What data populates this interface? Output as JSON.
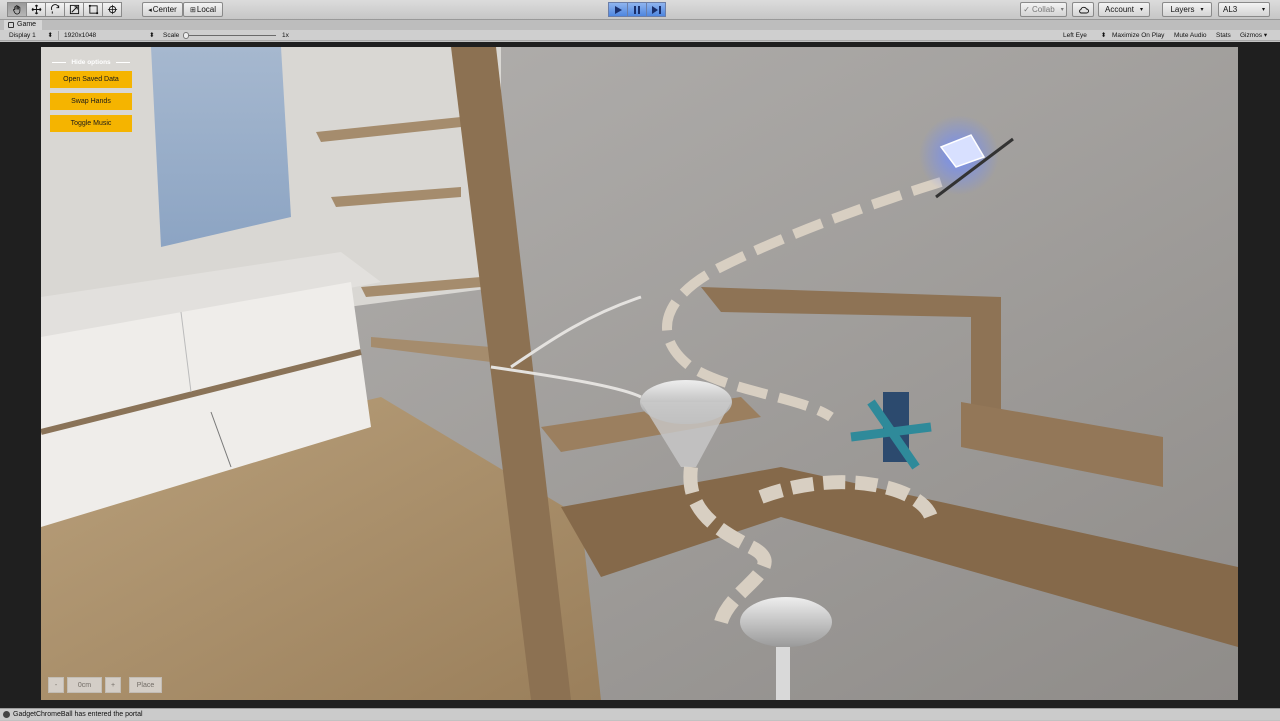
{
  "toolbar": {
    "tools": [
      "hand-tool",
      "move-tool",
      "rotate-tool",
      "scale-tool",
      "rect-tool",
      "transform-tool"
    ],
    "pivot_label": "Center",
    "space_label": "Local",
    "collab_label": "Collab",
    "account_label": "Account",
    "layers_label": "Layers",
    "layout_label": "AL3"
  },
  "tab": {
    "label": "Game"
  },
  "gamebar": {
    "display": "Display 1",
    "resolution": "1920x1048",
    "scale_label": "Scale",
    "scale_value": "1x",
    "scale_fraction": 0.0,
    "eye": "Left Eye",
    "maximize": "Maximize On Play",
    "mute": "Mute Audio",
    "stats": "Stats",
    "gizmos": "Gizmos"
  },
  "options": {
    "hide_label": "Hide options",
    "buttons": [
      "Open Saved Data",
      "Swap Hands",
      "Toggle Music"
    ]
  },
  "controls": {
    "minus": "-",
    "distance": "0cm",
    "plus": "+",
    "place": "Place"
  },
  "status": {
    "message": "GadgetChromeBall has entered the portal"
  },
  "colors": {
    "accent_button": "#f5b400",
    "play_active": "#4f86df"
  }
}
